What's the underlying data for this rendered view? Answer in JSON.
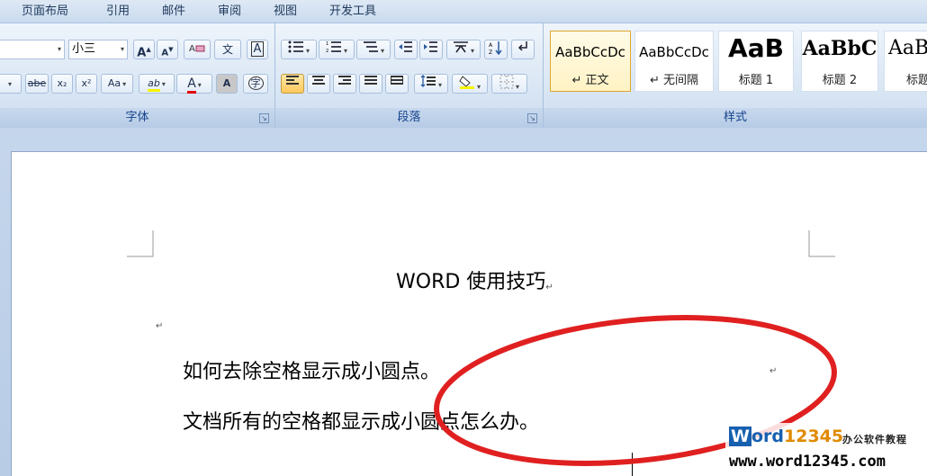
{
  "ribbon_tabs": [
    "页面布局",
    "引用",
    "邮件",
    "审阅",
    "视图",
    "开发工具"
  ],
  "font_group": {
    "label": "字体",
    "font_name_value": "",
    "font_size_value": "小三",
    "grow_font": "A",
    "shrink_font": "A",
    "phonetic": "文",
    "char_border": "A",
    "strikethrough": "abe",
    "subscript": "x₂",
    "superscript": "x²",
    "change_case": "Aa",
    "highlight": "ab",
    "font_color": "A",
    "char_shading": "A",
    "enclose": "字"
  },
  "paragraph_group": {
    "label": "段落"
  },
  "styles_group": {
    "label": "样式",
    "items": [
      {
        "sample": "AaBbCcDc",
        "name": "↵ 正文"
      },
      {
        "sample": "AaBbCcDc",
        "name": "↵ 无间隔"
      },
      {
        "sample": "AaB",
        "name": "标题 1"
      },
      {
        "sample": "AaBbC",
        "name": "标题 2"
      },
      {
        "sample": "AaB",
        "name": "标题"
      }
    ]
  },
  "document": {
    "title": "WORD 使用技巧",
    "line1": "如何去除空格显示成小圆点。",
    "line2": "文档所有的空格都显示成小圆点怎么办。",
    "para_mark": "↵"
  },
  "watermark": {
    "brand": "Word12345",
    "tagline": "办公软件教程",
    "url": "www.word12345.com"
  },
  "colors": {
    "annotation_circle": "#e02020",
    "font_color_bar": "#e00000",
    "highlight_bar": "#f6f400",
    "ribbon_label": "#15428b"
  }
}
